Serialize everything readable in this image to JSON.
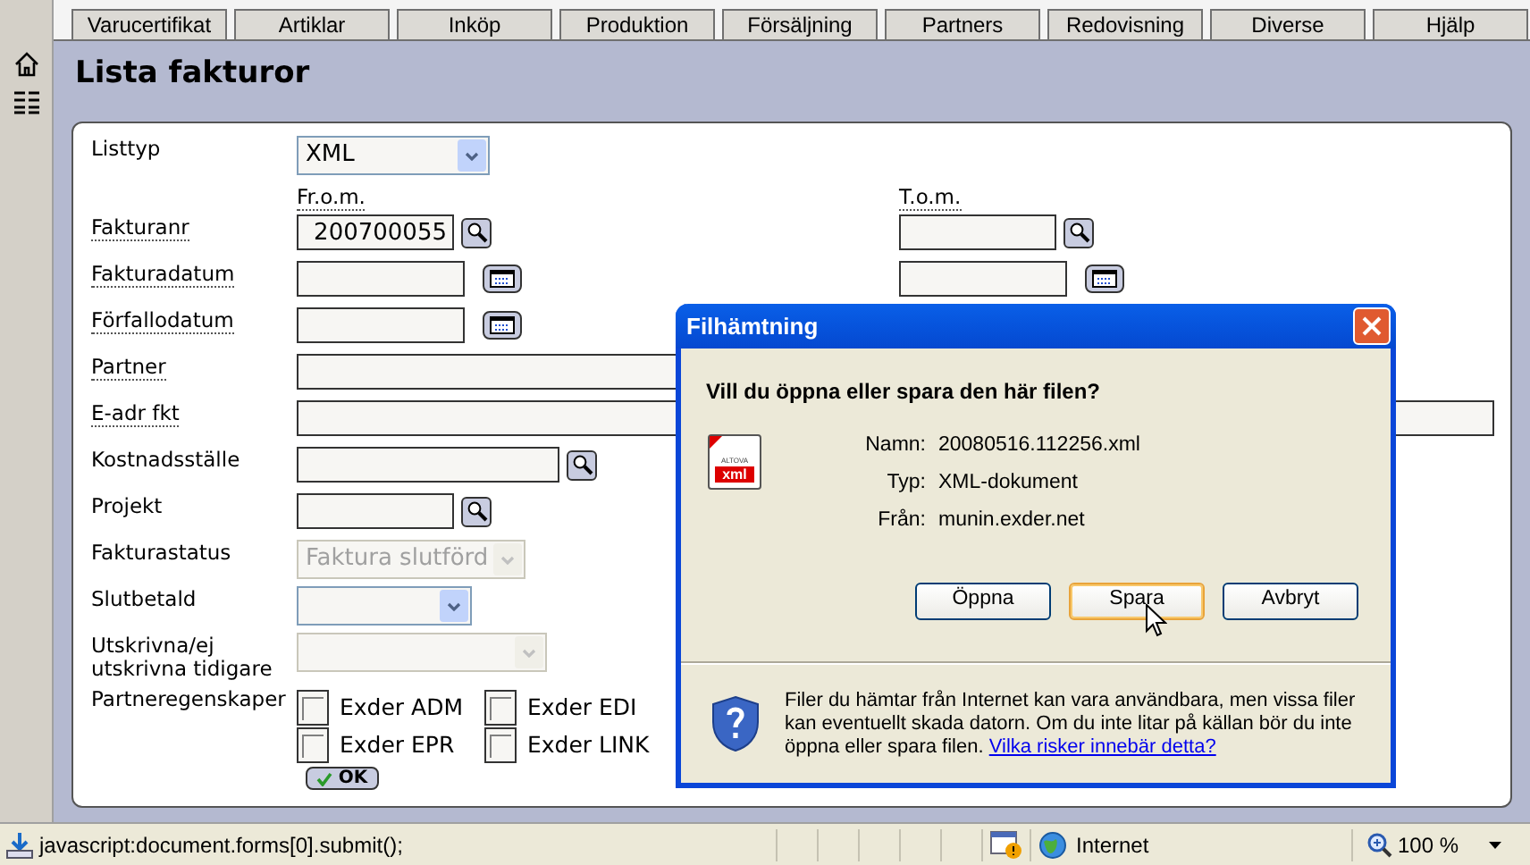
{
  "tabs": [
    {
      "label": "Varucertifikat",
      "selected": false
    },
    {
      "label": "Artiklar",
      "selected": false
    },
    {
      "label": "Inköp",
      "selected": false
    },
    {
      "label": "Produktion",
      "selected": false
    },
    {
      "label": "Försäljning",
      "selected": false
    },
    {
      "label": "Partners",
      "selected": false
    },
    {
      "label": "Redovisning",
      "selected": false
    },
    {
      "label": "Diverse",
      "selected": false
    },
    {
      "label": "Hjälp",
      "selected": false
    }
  ],
  "page_title": "Lista fakturor",
  "form": {
    "range_headers": {
      "from": "Fr.o.m.",
      "to": "T.o.m."
    },
    "rows": [
      {
        "kind": "select",
        "label": "Listtyp",
        "value": "XML",
        "disabled": false,
        "tooltip": false
      },
      {
        "kind": "header"
      },
      {
        "kind": "lookup",
        "label": "Fakturanr",
        "value": "200700055",
        "tooltip": true,
        "range": true
      },
      {
        "kind": "date",
        "label": "Fakturadatum",
        "tooltip": true,
        "range": true
      },
      {
        "kind": "date",
        "label": "Förfallodatum",
        "tooltip": true
      },
      {
        "kind": "text",
        "label": "Partner",
        "tooltip": true
      },
      {
        "kind": "text",
        "label": "E-adr fkt",
        "tooltip": true
      },
      {
        "kind": "lookup",
        "label": "Kostnadsställe",
        "tooltip": false
      },
      {
        "kind": "lookup",
        "label": "Projekt",
        "tooltip": false
      },
      {
        "kind": "select",
        "label": "Fakturastatus",
        "value": "Faktura slutförd",
        "disabled": true,
        "tooltip": false
      },
      {
        "kind": "select",
        "label": "Slutbetald",
        "disabled": false,
        "tooltip": false
      },
      {
        "kind": "select",
        "label": "Utskrivna/ej utskrivna tidigare",
        "disabled": true,
        "tooltip": false
      },
      {
        "kind": "checkboxes",
        "label": "Partneregenskaper",
        "options": [
          {
            "label": "Exder ADM",
            "checked": false
          },
          {
            "label": "Exder EPR",
            "checked": false
          },
          {
            "label": "Exder EDI",
            "checked": false
          },
          {
            "label": "Exder LINK",
            "checked": false
          }
        ]
      }
    ],
    "submit": "OK"
  },
  "dialog": {
    "title": "Filhämtning",
    "question": "Vill du öppna eller spara den här filen?",
    "file_icon": {
      "brand": "ALTOVA",
      "badge": "xml"
    },
    "details": [
      {
        "label": "Namn:",
        "value": "20080516.112256.xml"
      },
      {
        "label": "Typ:",
        "value": "XML-dokument"
      },
      {
        "label": "Från:",
        "value": "munin.exder.net"
      }
    ],
    "buttons": [
      {
        "label": "Öppna",
        "focused": false
      },
      {
        "label": "Spara",
        "focused": true
      },
      {
        "label": "Avbryt",
        "focused": false
      }
    ],
    "warning": "Filer du hämtar från Internet kan vara användbara, men vissa filer kan eventuellt skada datorn. Om du inte litar på källan bör du inte öppna eller spara filen.",
    "warning_link": "Vilka risker innebär detta?"
  },
  "status_bar": {
    "text": "javascript:document.forms[0].submit();",
    "zone": "Internet",
    "zoom": "100 %"
  }
}
